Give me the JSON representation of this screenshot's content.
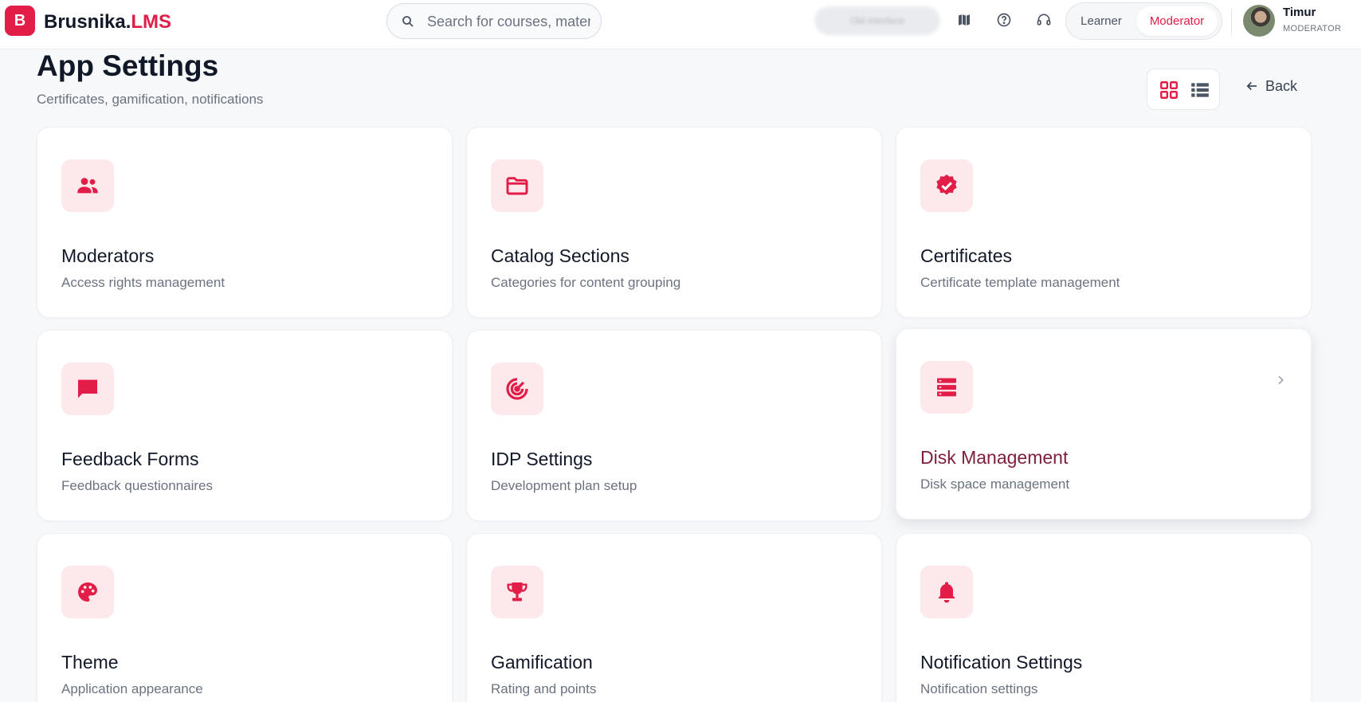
{
  "app": {
    "logo_letter": "B",
    "name_main": "Brusnika.",
    "name_accent": "LMS",
    "accent_color": "#e11d48"
  },
  "search": {
    "placeholder": "Search for courses, materi"
  },
  "header": {
    "blurred_button": "Old interface",
    "icons": [
      "map-icon",
      "help-icon",
      "headset-icon"
    ],
    "roles": {
      "learner": "Learner",
      "moderator": "Moderator",
      "active": "Moderator"
    },
    "user": {
      "name": "Timur",
      "role": "MODERATOR"
    }
  },
  "page": {
    "title": "App Settings",
    "subtitle": "Certificates, gamification, notifications",
    "back_label": "Back",
    "view_mode": "grid"
  },
  "cards": [
    {
      "title": "Moderators",
      "description": "Access rights management",
      "icon": "users-icon"
    },
    {
      "title": "Catalog Sections",
      "description": "Categories for content grouping",
      "icon": "folder-icon"
    },
    {
      "title": "Certificates",
      "description": "Certificate template management",
      "icon": "verified-badge-icon"
    },
    {
      "title": "Feedback Forms",
      "description": "Feedback questionnaires",
      "icon": "chat-bubble-icon"
    },
    {
      "title": "IDP Settings",
      "description": "Development plan setup",
      "icon": "target-icon"
    },
    {
      "title": "Disk Management",
      "description": "Disk space management",
      "icon": "storage-icon"
    },
    {
      "title": "Theme",
      "description": "Application appearance",
      "icon": "palette-icon"
    },
    {
      "title": "Gamification",
      "description": "Rating and points",
      "icon": "trophy-icon"
    },
    {
      "title": "Notification Settings",
      "description": "Notification settings",
      "icon": "bell-icon"
    }
  ]
}
